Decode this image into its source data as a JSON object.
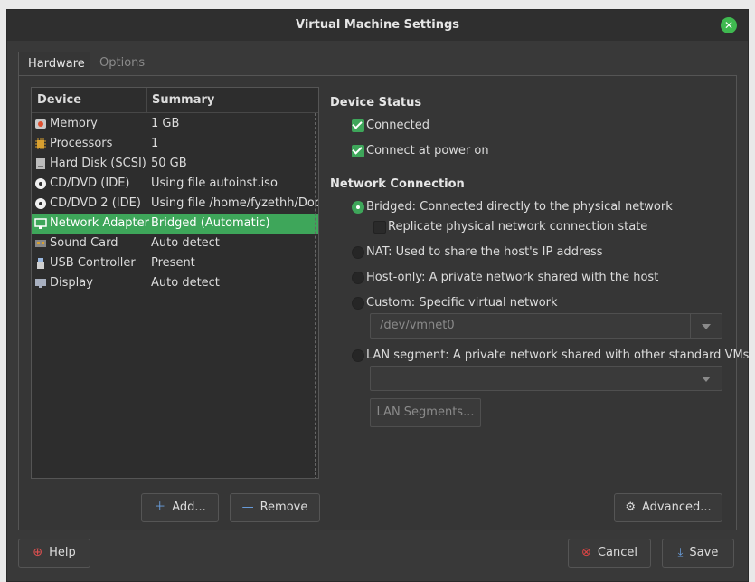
{
  "window": {
    "title": "Virtual Machine Settings"
  },
  "tabs": [
    {
      "label": "Hardware"
    },
    {
      "label": "Options"
    }
  ],
  "device_table": {
    "headers": {
      "device": "Device",
      "summary": "Summary"
    },
    "rows": [
      {
        "device": "Memory",
        "summary": "1 GB",
        "icon": "memory-icon"
      },
      {
        "device": "Processors",
        "summary": "1",
        "icon": "processor-icon"
      },
      {
        "device": "Hard Disk (SCSI)",
        "summary": "50 GB",
        "icon": "hard-disk-icon"
      },
      {
        "device": "CD/DVD (IDE)",
        "summary": "Using file autoinst.iso",
        "icon": "cd-dvd-icon"
      },
      {
        "device": "CD/DVD 2 (IDE)",
        "summary": "Using file /home/fyzethh/Docu",
        "icon": "cd-dvd-icon"
      },
      {
        "device": "Network Adapter",
        "summary": "Bridged (Automatic)",
        "icon": "network-adapter-icon",
        "selected": true
      },
      {
        "device": "Sound Card",
        "summary": "Auto detect",
        "icon": "sound-card-icon"
      },
      {
        "device": "USB Controller",
        "summary": "Present",
        "icon": "usb-icon"
      },
      {
        "device": "Display",
        "summary": "Auto detect",
        "icon": "display-icon"
      }
    ]
  },
  "device_buttons": {
    "add": "Add...",
    "remove": "Remove"
  },
  "device_status": {
    "title": "Device Status",
    "connected": "Connected",
    "connect_at_power_on": "Connect at power on"
  },
  "network_connection": {
    "title": "Network Connection",
    "bridged": "Bridged: Connected directly to the physical network",
    "replicate": "Replicate physical network connection state",
    "nat": "NAT: Used to share the host's IP address",
    "host_only": "Host-only: A private network shared with the host",
    "custom": "Custom: Specific virtual network",
    "custom_value": "/dev/vmnet0",
    "lan_segment": "LAN segment: A private network shared with other standard VMs",
    "lan_segment_value": "",
    "lan_segments_button": "LAN Segments..."
  },
  "advanced_button": "Advanced...",
  "footer": {
    "help": "Help",
    "cancel": "Cancel",
    "save": "Save"
  },
  "colors": {
    "accent": "#3ea65a",
    "window_bg": "#393939",
    "panel_bg": "#363636"
  }
}
